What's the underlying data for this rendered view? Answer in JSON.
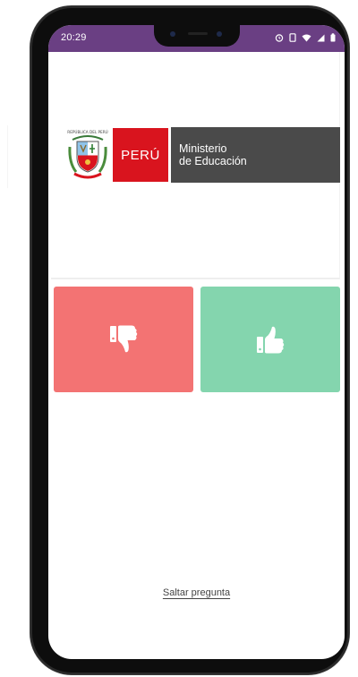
{
  "status_bar": {
    "time": "20:29",
    "icons": [
      "alarm-icon",
      "vibrate-icon",
      "wifi-icon",
      "signal-icon",
      "battery-icon"
    ],
    "background": "#6a3f83"
  },
  "header": {
    "logo": {
      "emblem_text": "REPÚBLICA DEL PERÚ",
      "country": "PERÚ",
      "ministry_line1": "Ministerio",
      "ministry_line2": "de Educación"
    }
  },
  "vote": {
    "dislike": {
      "icon": "thumbs-down-icon",
      "color": "#f37373"
    },
    "like": {
      "icon": "thumbs-up-icon",
      "color": "#84d5ae"
    }
  },
  "skip": {
    "label": "Saltar pregunta"
  }
}
